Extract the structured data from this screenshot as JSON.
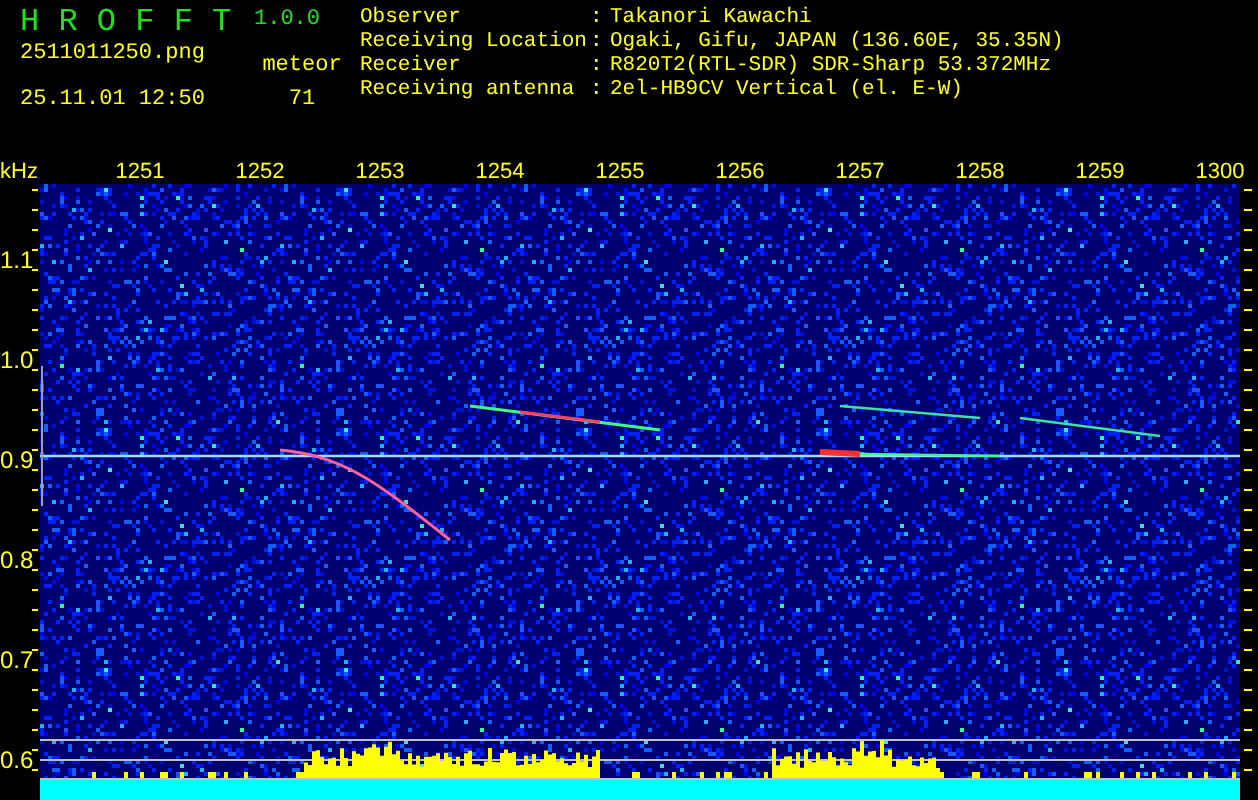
{
  "app": {
    "name": "H R O F F T",
    "version": "1.0.0"
  },
  "file": "2511011250.png",
  "timestamp": "25.11.01 12:50",
  "meteor": {
    "label": "meteor",
    "count": "71"
  },
  "info": [
    {
      "label": "Observer",
      "separator": ":",
      "value": "Takanori Kawachi"
    },
    {
      "label": "Receiving Location",
      "separator": ":",
      "value": "Ogaki, Gifu, JAPAN (136.60E, 35.35N)"
    },
    {
      "label": "Receiver",
      "separator": ":",
      "value": "R820T2(RTL-SDR) SDR-Sharp 53.372MHz"
    },
    {
      "label": "Receiving antenna",
      "separator": ":",
      "value": "2el-HB9CV Vertical (el. E-W)"
    }
  ],
  "plot": {
    "unit": "kHz",
    "time_labels": [
      "1251",
      "1252",
      "1253",
      "1254",
      "1255",
      "1256",
      "1257",
      "1258",
      "1259",
      "1300"
    ],
    "freq_labels": [
      "1.1",
      "1.0",
      "0.9",
      "0.8",
      "0.7",
      "0.6"
    ]
  }
}
